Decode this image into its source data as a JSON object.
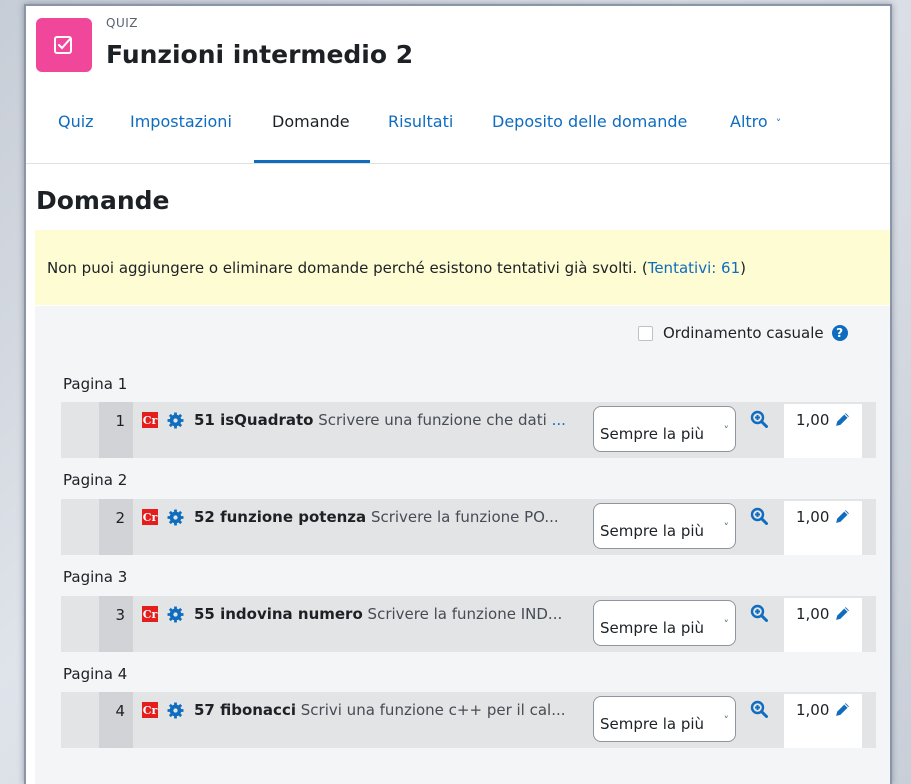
{
  "header": {
    "kind": "QUIZ",
    "title": "Funzioni intermedio 2"
  },
  "tabs": [
    {
      "label": "Quiz",
      "active": false
    },
    {
      "label": "Impostazioni",
      "active": false
    },
    {
      "label": "Domande",
      "active": true
    },
    {
      "label": "Risultati",
      "active": false
    },
    {
      "label": "Deposito delle domande",
      "active": false
    },
    {
      "label": "Altro",
      "active": false,
      "icon": "chevron-down-icon"
    }
  ],
  "main": {
    "heading": "Domande",
    "notice": {
      "text": "Non puoi aggiungere o eliminare domande perché esistono tentativi già svolti. (",
      "link": "Tentativi: 61",
      "suffix": ")"
    },
    "shuffle": {
      "label": "Ordinamento casuale",
      "checked": false,
      "help_icon": "question-circle-icon"
    }
  },
  "pages": [
    {
      "label": "Pagina 1",
      "slot": {
        "number": "1",
        "name": "51 isQuadrato",
        "text": "Scrivere una funzione che dati",
        "ellipsis": "...",
        "select": "Sempre la più",
        "mark": "1,00"
      }
    },
    {
      "label": "Pagina 2",
      "slot": {
        "number": "2",
        "name": "52 funzione potenza",
        "text": "Scrivere la funzione PO...",
        "ellipsis": "",
        "select": "Sempre la più",
        "mark": "1,00"
      }
    },
    {
      "label": "Pagina 3",
      "slot": {
        "number": "3",
        "name": "55 indovina numero",
        "text": "Scrivere la funzione IND...",
        "ellipsis": "",
        "select": "Sempre la più",
        "mark": "1,00"
      }
    },
    {
      "label": "Pagina 4",
      "slot": {
        "number": "4",
        "name": "57 fibonacci",
        "text": "Scrivi una funzione c++ per il cal...",
        "ellipsis": "",
        "select": "Sempre la più",
        "mark": "1,00"
      }
    }
  ],
  "icons": {
    "question_type": "Cr",
    "colors": {
      "quiz_icon": "#f0479a",
      "link": "#0f6cbf",
      "notice_bg": "#fdfcd2",
      "qtype_badge": "#e41d1d"
    }
  }
}
